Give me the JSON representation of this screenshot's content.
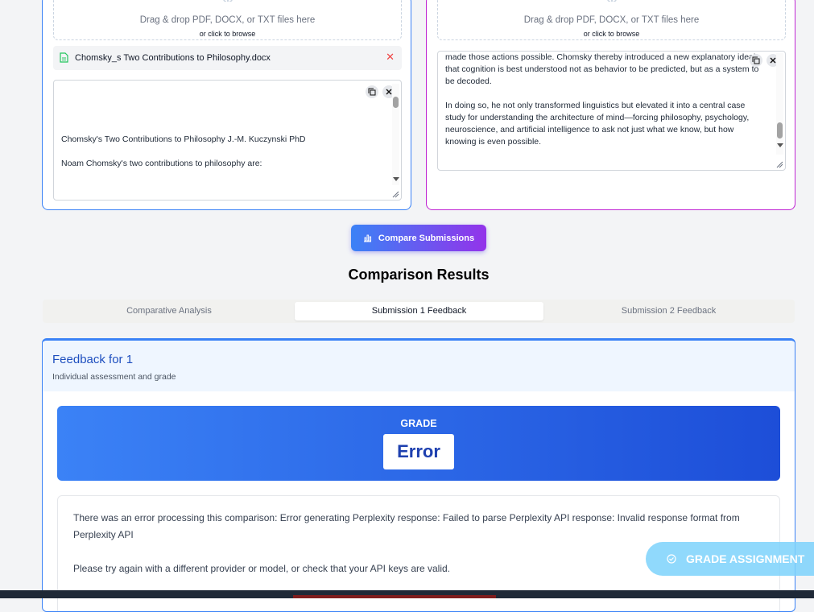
{
  "submission1": {
    "dropzone_text": "Drag & drop PDF, DOCX, or TXT files here",
    "dropzone_sub": "or click to browse",
    "file_name": "Chomsky_s Two Contributions to Philosophy.docx",
    "remove_glyph": "✕",
    "text_line1": "Chomsky's Two Contributions to Philosophy J.-M. Kuczynski PhD",
    "text_line2": "Noam Chomsky's two contributions to philosophy are:"
  },
  "submission2": {
    "dropzone_text": "Drag & drop PDF, DOCX, or TXT files here",
    "dropzone_sub": "or click to browse",
    "text_lines": [
      "made those actions possible. Chomsky thereby introduced a new explanatory ideal:",
      "that cognition is best understood not as behavior to be predicted, but as a system to",
      "be decoded.",
      "",
      "In doing so, he not only transformed linguistics but elevated it into a central case",
      "study for understanding the architecture of mind—forcing philosophy, psychology,",
      "neuroscience, and artificial intelligence to ask not just what we know, but how",
      "knowing is even possible."
    ]
  },
  "compare_button_label": "Compare Submissions",
  "results_title": "Comparison Results",
  "tabs": [
    {
      "label": "Comparative Analysis"
    },
    {
      "label": "Submission 1 Feedback"
    },
    {
      "label": "Submission 2 Feedback"
    }
  ],
  "active_tab": "Submission 1 Feedback",
  "feedback": {
    "title": "Feedback for 1",
    "subtitle": "Individual assessment and grade",
    "grade_label": "GRADE",
    "grade_value": "Error",
    "error_text": "There was an error processing this comparison: Error generating Perplexity response: Failed to parse Perplexity API response: Invalid response format from Perplexity API",
    "retry_text": "Please try again with a different provider or model, or check that your API keys are valid."
  },
  "grade_assignment_label": "GRADE ASSIGNMENT",
  "icons": [
    "upload-icon",
    "document-icon",
    "copy-icon",
    "close-icon",
    "chart-icon",
    "check-circle-icon"
  ],
  "colors": {
    "accent_blue": "#3b82f6",
    "accent_purple": "#9333ea",
    "panel2_border": "#c026d3",
    "error_red": "#ef4444",
    "grade_blue": "#1d4ed8",
    "floating_button": "#7dd3fc"
  }
}
